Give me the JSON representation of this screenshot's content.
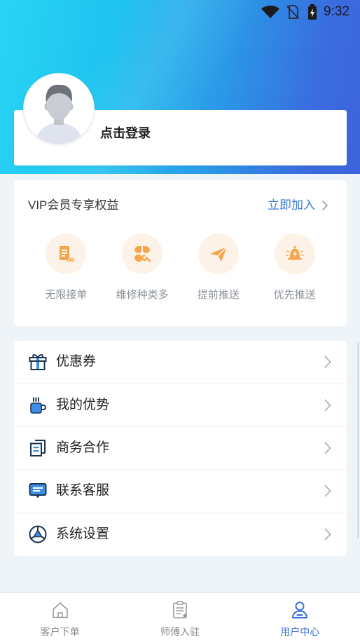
{
  "status_bar": {
    "time": "9:32",
    "icons": [
      "wifi-icon",
      "no-sim-icon",
      "battery-charging-icon"
    ]
  },
  "profile": {
    "login_text": "点击登录",
    "avatar_icon": "default-avatar-icon"
  },
  "vip": {
    "title": "VIP会员专享权益",
    "join_label": "立即加入",
    "benefits": [
      {
        "label": "无限接单",
        "icon": "unlimited-orders-icon"
      },
      {
        "label": "维修种类多",
        "icon": "repair-categories-icon"
      },
      {
        "label": "提前推送",
        "icon": "paper-plane-icon"
      },
      {
        "label": "优先推送",
        "icon": "priority-alarm-icon"
      }
    ]
  },
  "menu": [
    {
      "label": "优惠券",
      "icon": "gift-icon"
    },
    {
      "label": "我的优势",
      "icon": "cup-icon"
    },
    {
      "label": "商务合作",
      "icon": "documents-icon"
    },
    {
      "label": "联系客服",
      "icon": "chat-icon"
    },
    {
      "label": "系统设置",
      "icon": "settings-icon"
    }
  ],
  "tabbar": [
    {
      "label": "客户下单",
      "icon": "home-icon",
      "active": false
    },
    {
      "label": "师傅入驻",
      "icon": "clipboard-icon",
      "active": false
    },
    {
      "label": "用户中心",
      "icon": "user-icon",
      "active": true
    }
  ],
  "colors": {
    "header_gradient_start": "#2ad3f4",
    "header_gradient_end": "#3d63dc",
    "page_background": "#eff4f8",
    "accent_link": "#3b7ad8",
    "benefit_icon": "#f5a64a",
    "benefit_icon_bg": "#fdf2e7",
    "menu_icon_dark": "#1e3452",
    "menu_icon_blue": "#3a8fe6",
    "tab_active": "#3a6fd8",
    "tab_inactive": "#8a8a8a"
  }
}
